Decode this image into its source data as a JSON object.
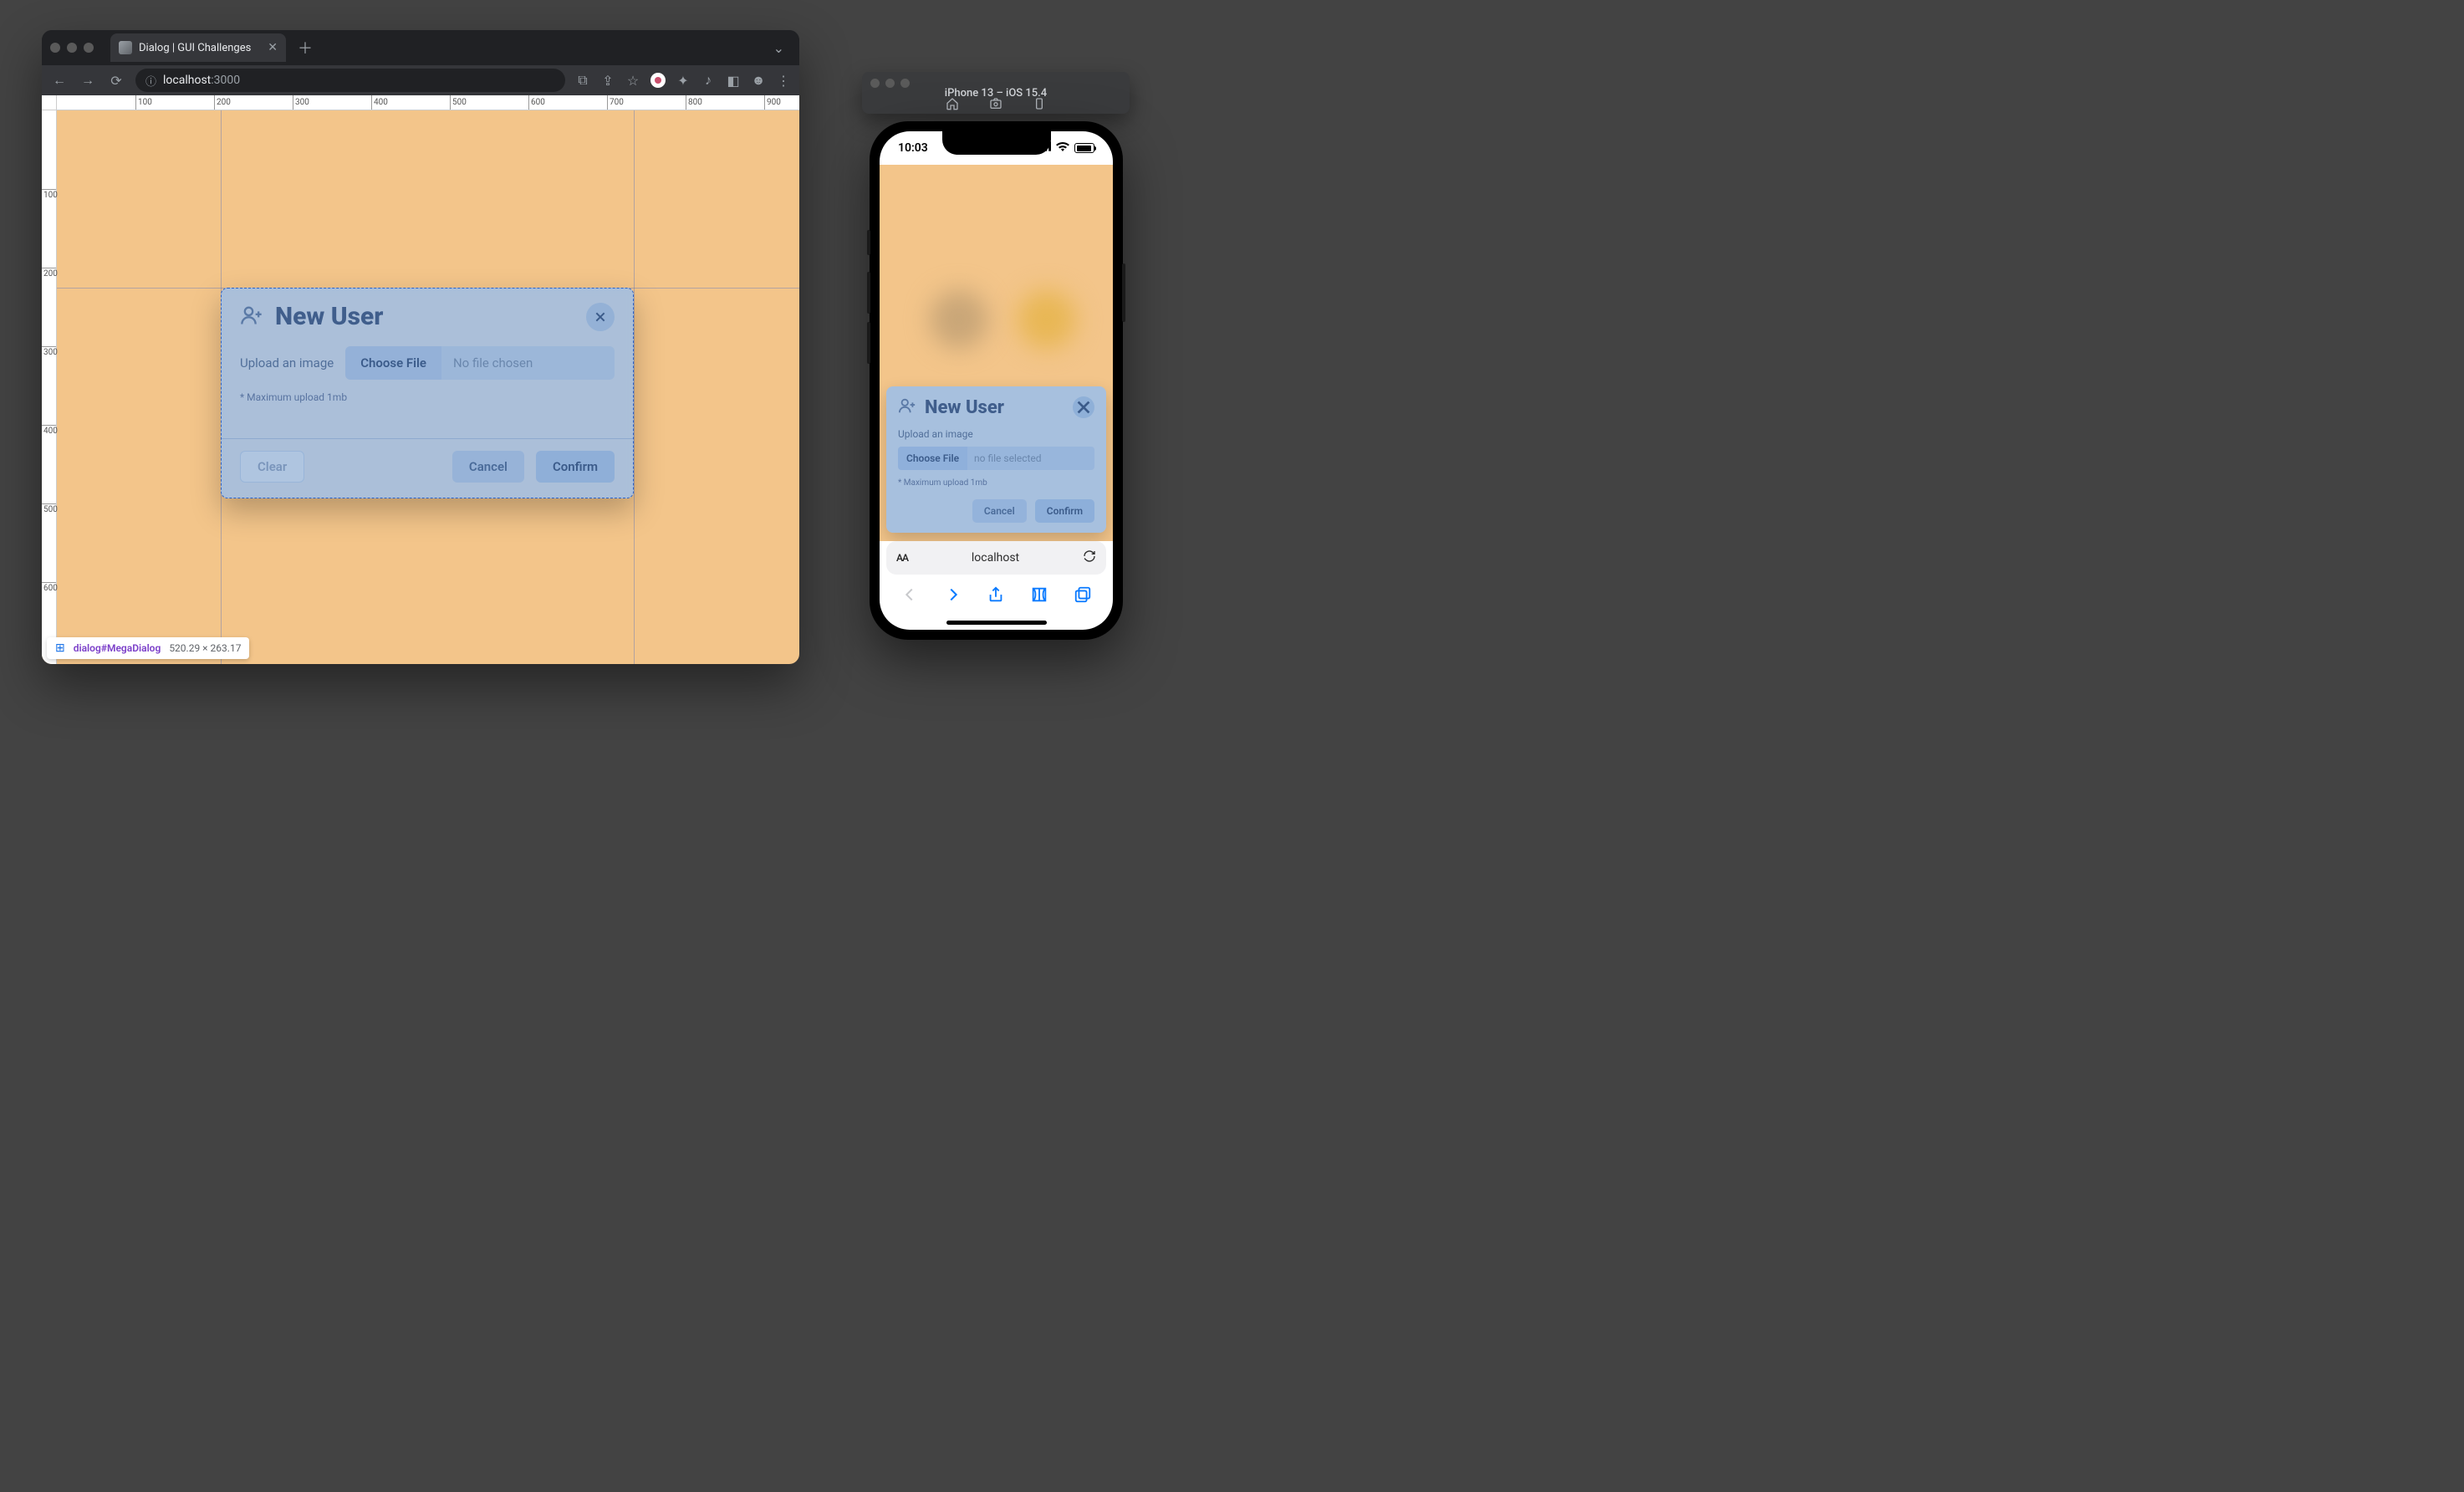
{
  "browser": {
    "tab_title": "Dialog | GUI Challenges",
    "url_host": "localhost",
    "url_port": ":3000",
    "ruler_h": [
      "100",
      "200",
      "300",
      "400",
      "500",
      "600",
      "700",
      "800",
      "900"
    ],
    "ruler_v": [
      "100",
      "200",
      "300",
      "400",
      "500",
      "600"
    ]
  },
  "dialog": {
    "title": "New User",
    "upload_label": "Upload an image",
    "choose_file": "Choose File",
    "no_file": "No file chosen",
    "hint": "* Maximum upload 1mb",
    "clear": "Clear",
    "cancel": "Cancel",
    "confirm": "Confirm"
  },
  "devtools_pill": {
    "selector": "dialog#MegaDialog",
    "dims": "520.29 × 263.17"
  },
  "simulator": {
    "title": "iPhone 13 – iOS 15.4"
  },
  "phone": {
    "time": "10:03",
    "host": "localhost"
  },
  "mdialog": {
    "title": "New User",
    "upload_label": "Upload an image",
    "choose_file": "Choose File",
    "no_file": "no file selected",
    "hint": "* Maximum upload 1mb",
    "cancel": "Cancel",
    "confirm": "Confirm"
  }
}
